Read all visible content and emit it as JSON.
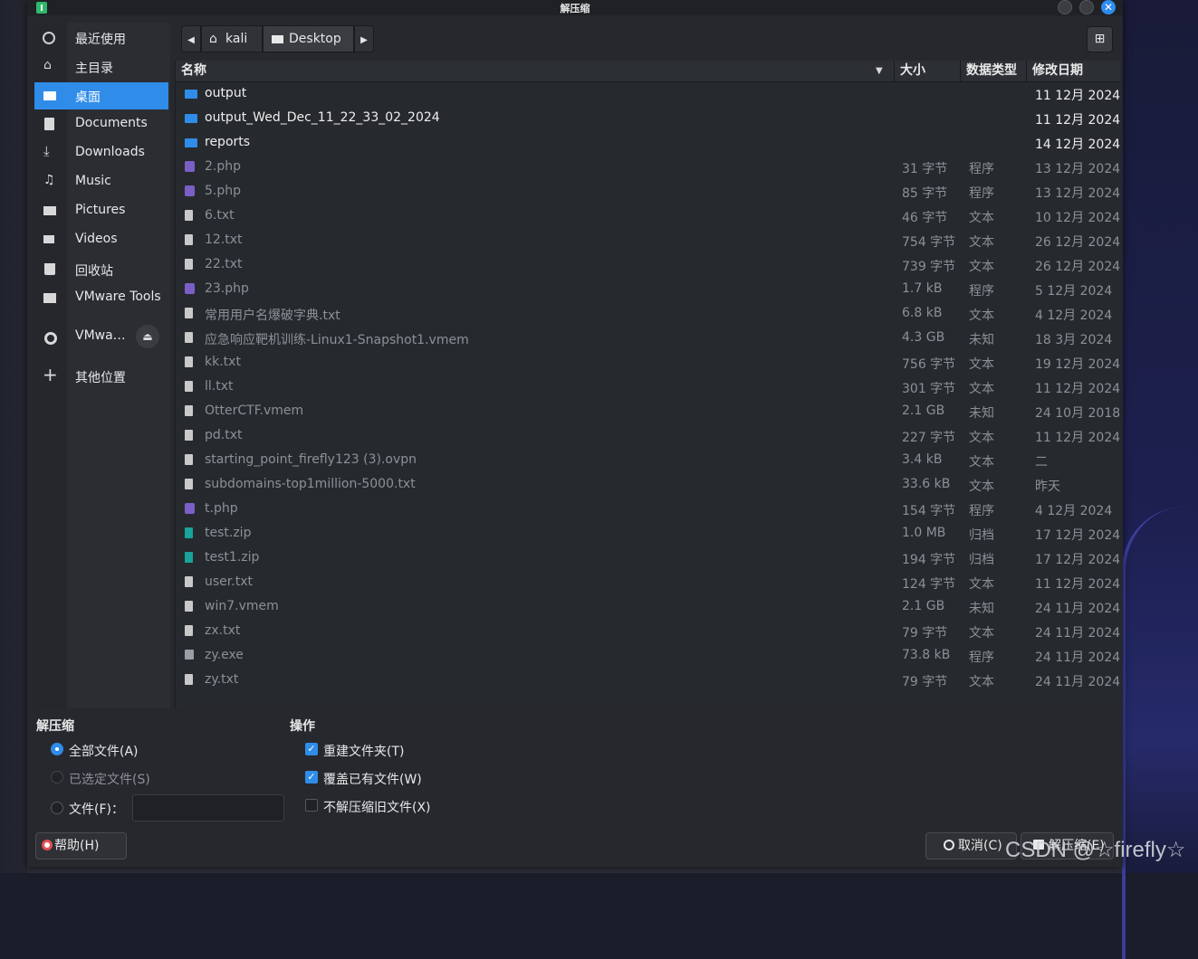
{
  "window": {
    "title": "解压缩"
  },
  "sidebar": {
    "items": [
      {
        "label": "最近使用",
        "icon": "clock-icon"
      },
      {
        "label": "主目录",
        "icon": "home-icon"
      },
      {
        "label": "桌面",
        "icon": "desktop-icon",
        "active": true
      },
      {
        "label": "Documents",
        "icon": "document-icon"
      },
      {
        "label": "Downloads",
        "icon": "download-icon"
      },
      {
        "label": "Music",
        "icon": "music-icon"
      },
      {
        "label": "Pictures",
        "icon": "picture-icon"
      },
      {
        "label": "Videos",
        "icon": "video-icon"
      },
      {
        "label": "回收站",
        "icon": "trash-icon"
      },
      {
        "label": "VMware Tools",
        "icon": "folder-icon"
      }
    ],
    "mount": {
      "label": "VMwa…",
      "icon": "disc-icon"
    },
    "other": {
      "label": "其他位置",
      "icon": "plus-icon"
    }
  },
  "pathbar": {
    "home": "kali",
    "current": "Desktop"
  },
  "columns": {
    "name": "名称",
    "size": "大小",
    "type": "数据类型",
    "date": "修改日期"
  },
  "files": [
    {
      "name": "output",
      "size": "",
      "type": "",
      "date": "11 12月 2024",
      "kind": "folder"
    },
    {
      "name": "output_Wed_Dec_11_22_33_02_2024",
      "size": "",
      "type": "",
      "date": "11 12月 2024",
      "kind": "folder"
    },
    {
      "name": "reports",
      "size": "",
      "type": "",
      "date": "14 12月 2024",
      "kind": "folder"
    },
    {
      "name": "2.php",
      "size": "31 字节",
      "type": "程序",
      "date": "13 12月 2024",
      "kind": "php"
    },
    {
      "name": "5.php",
      "size": "85 字节",
      "type": "程序",
      "date": "13 12月 2024",
      "kind": "php"
    },
    {
      "name": "6.txt",
      "size": "46 字节",
      "type": "文本",
      "date": "10 12月 2024",
      "kind": "doc"
    },
    {
      "name": "12.txt",
      "size": "754 字节",
      "type": "文本",
      "date": "26 12月 2024",
      "kind": "doc"
    },
    {
      "name": "22.txt",
      "size": "739 字节",
      "type": "文本",
      "date": "26 12月 2024",
      "kind": "doc"
    },
    {
      "name": "23.php",
      "size": "1.7 kB",
      "type": "程序",
      "date": "5 12月 2024",
      "kind": "php"
    },
    {
      "name": "常用用户名爆破字典.txt",
      "size": "6.8 kB",
      "type": "文本",
      "date": "4 12月 2024",
      "kind": "doc"
    },
    {
      "name": "应急响应靶机训练-Linux1-Snapshot1.vmem",
      "size": "4.3 GB",
      "type": "未知",
      "date": "18 3月 2024",
      "kind": "doc"
    },
    {
      "name": "kk.txt",
      "size": "756 字节",
      "type": "文本",
      "date": "19 12月 2024",
      "kind": "doc"
    },
    {
      "name": "ll.txt",
      "size": "301 字节",
      "type": "文本",
      "date": "11 12月 2024",
      "kind": "doc"
    },
    {
      "name": "OtterCTF.vmem",
      "size": "2.1 GB",
      "type": "未知",
      "date": "24 10月 2018",
      "kind": "doc"
    },
    {
      "name": "pd.txt",
      "size": "227 字节",
      "type": "文本",
      "date": "11 12月 2024",
      "kind": "doc"
    },
    {
      "name": "starting_point_firefly123 (3).ovpn",
      "size": "3.4 kB",
      "type": "文本",
      "date": "二",
      "kind": "doc"
    },
    {
      "name": "subdomains-top1million-5000.txt",
      "size": "33.6 kB",
      "type": "文本",
      "date": "昨天",
      "kind": "doc"
    },
    {
      "name": "t.php",
      "size": "154 字节",
      "type": "程序",
      "date": "4 12月 2024",
      "kind": "php"
    },
    {
      "name": "test.zip",
      "size": "1.0 MB",
      "type": "归档",
      "date": "17 12月 2024",
      "kind": "zip"
    },
    {
      "name": "test1.zip",
      "size": "194 字节",
      "type": "归档",
      "date": "17 12月 2024",
      "kind": "zip"
    },
    {
      "name": "user.txt",
      "size": "124 字节",
      "type": "文本",
      "date": "11 12月 2024",
      "kind": "doc"
    },
    {
      "name": "win7.vmem",
      "size": "2.1 GB",
      "type": "未知",
      "date": "24 11月 2024",
      "kind": "doc"
    },
    {
      "name": "zx.txt",
      "size": "79 字节",
      "type": "文本",
      "date": "24 11月 2024",
      "kind": "doc"
    },
    {
      "name": "zy.exe",
      "size": "73.8 kB",
      "type": "程序",
      "date": "24 11月 2024",
      "kind": "exe"
    },
    {
      "name": "zy.txt",
      "size": "79 字节",
      "type": "文本",
      "date": "24 11月 2024",
      "kind": "doc"
    }
  ],
  "extract": {
    "heading": "解压缩",
    "all_files": "全部文件(A)",
    "selected_files": "已选定文件(S)",
    "files": "文件(F)：",
    "files_value": ""
  },
  "actions": {
    "heading": "操作",
    "recreate_folders": "重建文件夹(T)",
    "overwrite": "覆盖已有文件(W)",
    "no_extract_older": "不解压缩旧文件(X)"
  },
  "buttons": {
    "help": "帮助(H)",
    "cancel": "取消(C)",
    "extract": "解压缩(E)"
  },
  "watermark": "CSDN @☆firefly☆",
  "colors": {
    "accent": "#2f8ce8",
    "folder": "#2f8ce8",
    "php": "#7b5fc6",
    "zip": "#19a39a"
  }
}
